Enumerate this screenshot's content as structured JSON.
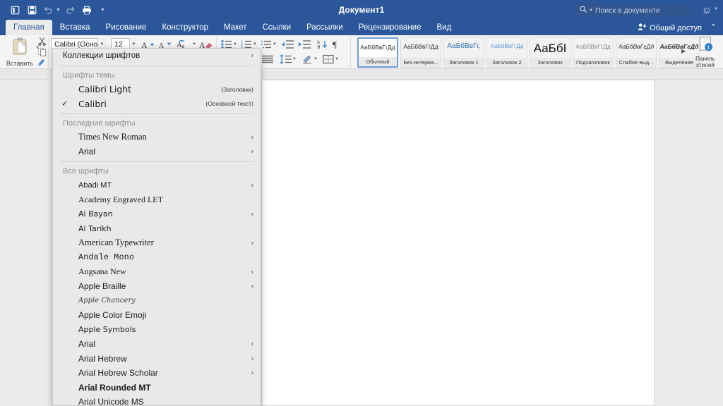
{
  "titlebar": {
    "title": "Документ1",
    "quick_access": [
      {
        "name": "new-document-icon",
        "label": "Создать"
      },
      {
        "name": "save-icon",
        "label": "Сохранить"
      },
      {
        "name": "undo-icon",
        "label": "Отменить"
      },
      {
        "name": "redo-icon",
        "label": "Вернуть"
      },
      {
        "name": "print-icon",
        "label": "Печать"
      },
      {
        "name": "customize-caret-icon",
        "label": "Настроить"
      }
    ],
    "search_placeholder": "Поиск в документе",
    "search_icon": "search-icon",
    "account_icon": "smiley-account-icon"
  },
  "tabs": [
    {
      "label": "Главная",
      "active": true
    },
    {
      "label": "Вставка",
      "active": false
    },
    {
      "label": "Рисование",
      "active": false
    },
    {
      "label": "Конструктор",
      "active": false
    },
    {
      "label": "Макет",
      "active": false
    },
    {
      "label": "Ссылки",
      "active": false
    },
    {
      "label": "Рассылки",
      "active": false
    },
    {
      "label": "Рецензирование",
      "active": false
    },
    {
      "label": "Вид",
      "active": false
    }
  ],
  "share": {
    "label": "Общий доступ",
    "icon": "person-add-icon",
    "collapse_icon": "chevron-up-icon"
  },
  "ribbon": {
    "paste_label": "Вставить",
    "font_name": "Calibri (Осно...",
    "font_size": "12",
    "style_gallery": [
      {
        "sample": "АаБбВвГгДд",
        "name": "Обычный",
        "selected": true,
        "face": "plain"
      },
      {
        "sample": "АаБбВвГгДд",
        "name": "Без интерва...",
        "selected": false,
        "face": "plain"
      },
      {
        "sample": "АаБбВвГг,",
        "name": "Заголовок 1",
        "selected": false,
        "face": "h1"
      },
      {
        "sample": "АаБбВвГгДд",
        "name": "Заголовок 2",
        "selected": false,
        "face": "h2"
      },
      {
        "sample": "АаБбІ",
        "name": "Заголовок",
        "selected": false,
        "face": "big"
      },
      {
        "sample": "АаБбВвГгДд",
        "name": "Подзаголовок",
        "selected": false,
        "face": "dim"
      },
      {
        "sample": "АаБбВвГгДд",
        "name": "Слабое выд...",
        "selected": false,
        "face": "it"
      },
      {
        "sample": "АаБбВвГгДд",
        "name": "Выделение",
        "selected": false,
        "face": "bi"
      }
    ],
    "style_pane_label_1": "Панель",
    "style_pane_label_2": "стилей",
    "style_pane_badge": "1"
  },
  "font_menu": {
    "collections_label": "Коллекции шрифтов",
    "theme_header": "Шрифты темы",
    "theme_fonts": [
      {
        "label": "Calibri Light",
        "tail": "(Заголовки)",
        "checked": false,
        "face": "f-calibri-lt"
      },
      {
        "label": "Calibri",
        "tail": "(Основной текст)",
        "checked": true,
        "face": "f-calibri"
      }
    ],
    "recent_header": "Последние шрифты",
    "recent_fonts": [
      {
        "label": "Times New Roman",
        "submenu": true,
        "face": "f-serif"
      },
      {
        "label": "Arial",
        "submenu": true,
        "face": "f-sans"
      }
    ],
    "all_header": "Все шрифты",
    "all_fonts": [
      {
        "label": "Abadi MT",
        "submenu": true,
        "face": "f-cond"
      },
      {
        "label": "Academy Engraved LET",
        "submenu": false,
        "face": "f-serif"
      },
      {
        "label": "Al Bayan",
        "submenu": true,
        "face": "f-dj"
      },
      {
        "label": "Al Tarikh",
        "submenu": false,
        "face": "f-dj"
      },
      {
        "label": "American Typewriter",
        "submenu": true,
        "face": "f-serif"
      },
      {
        "label": "Andale Mono",
        "submenu": false,
        "face": "f-mono"
      },
      {
        "label": "Angsana New",
        "submenu": true,
        "face": "f-serif"
      },
      {
        "label": "Apple Braille",
        "submenu": true,
        "face": "f-sans"
      },
      {
        "label": "Apple Chancery",
        "submenu": false,
        "face": "f-cursive"
      },
      {
        "label": "Apple Color Emoji",
        "submenu": false,
        "face": "f-sans"
      },
      {
        "label": "Apple Symbols",
        "submenu": false,
        "face": "f-dj"
      },
      {
        "label": "Arial",
        "submenu": true,
        "face": "f-sans"
      },
      {
        "label": "Arial Hebrew",
        "submenu": true,
        "face": "f-sans"
      },
      {
        "label": "Arial Hebrew Scholar",
        "submenu": true,
        "face": "f-sans"
      },
      {
        "label": "Arial Rounded MT",
        "submenu": false,
        "face": "f-bold"
      },
      {
        "label": "Arial Unicode MS",
        "submenu": false,
        "face": "f-sans"
      }
    ],
    "submenu_icon": "chevron-right-icon",
    "check_icon": "checkmark-icon"
  },
  "colors": {
    "titlebar": "#2b579a",
    "ribbon": "#f4f4f4",
    "canvas": "#ebebeb",
    "menu": "#e9e9e9",
    "page": "#ffffff",
    "accent_blue": "#2e74b5"
  }
}
